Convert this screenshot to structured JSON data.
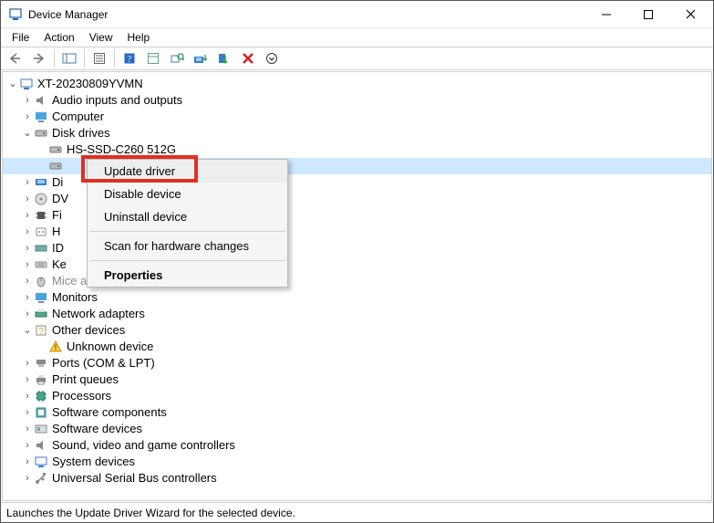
{
  "window": {
    "title": "Device Manager"
  },
  "menu": {
    "file": "File",
    "action": "Action",
    "view": "View",
    "help": "Help"
  },
  "tree": {
    "root": "XT-20230809YVMN",
    "n_audio": "Audio inputs and outputs",
    "n_computer": "Computer",
    "n_disk": "Disk drives",
    "n_disk_ssd": "HS-SSD-C260 512G",
    "n_display": "Di",
    "n_dvd": "DV",
    "n_firmware": "Fi",
    "n_hid": "H",
    "n_ide": "ID",
    "n_keyboards": "Ke",
    "n_mice": "Mice and other pointing devices",
    "n_monitors": "Monitors",
    "n_network": "Network adapters",
    "n_other": "Other devices",
    "n_unknown": "Unknown device",
    "n_ports": "Ports (COM & LPT)",
    "n_printq": "Print queues",
    "n_proc": "Processors",
    "n_swcomp": "Software components",
    "n_swdev": "Software devices",
    "n_sound": "Sound, video and game controllers",
    "n_sysdev": "System devices",
    "n_usb": "Universal Serial Bus controllers"
  },
  "context_menu": {
    "update": "Update driver",
    "disable": "Disable device",
    "uninstall": "Uninstall device",
    "scan": "Scan for hardware changes",
    "properties": "Properties"
  },
  "statusbar": {
    "text": "Launches the Update Driver Wizard for the selected device."
  }
}
